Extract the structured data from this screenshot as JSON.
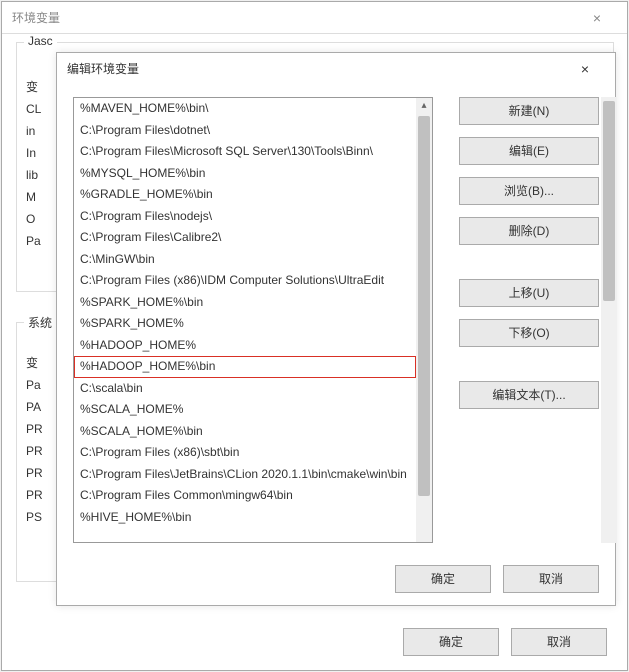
{
  "outer": {
    "title": "环境变量",
    "close": "×",
    "group1_label": "Jasc",
    "group2_label": "系统",
    "left_col_1": [
      "变",
      "CL",
      "in",
      "In",
      "lib",
      "M",
      "O",
      "Pa"
    ],
    "left_col_2": [
      "变",
      "Pa",
      "PA",
      "PR",
      "PR",
      "PR",
      "PR",
      "PS"
    ],
    "ok": "确定",
    "cancel": "取消"
  },
  "inner": {
    "title": "编辑环境变量",
    "close": "×",
    "list": [
      {
        "text": "%MAVEN_HOME%\\bin\\",
        "hl": false
      },
      {
        "text": "C:\\Program Files\\dotnet\\",
        "hl": false
      },
      {
        "text": "C:\\Program Files\\Microsoft SQL Server\\130\\Tools\\Binn\\",
        "hl": false
      },
      {
        "text": "%MYSQL_HOME%\\bin",
        "hl": false
      },
      {
        "text": "%GRADLE_HOME%\\bin",
        "hl": false
      },
      {
        "text": "C:\\Program Files\\nodejs\\",
        "hl": false
      },
      {
        "text": "C:\\Program Files\\Calibre2\\",
        "hl": false
      },
      {
        "text": "C:\\MinGW\\bin",
        "hl": false
      },
      {
        "text": "C:\\Program Files (x86)\\IDM Computer Solutions\\UltraEdit",
        "hl": false
      },
      {
        "text": "%SPARK_HOME%\\bin",
        "hl": false
      },
      {
        "text": "%SPARK_HOME%",
        "hl": false
      },
      {
        "text": "%HADOOP_HOME%",
        "hl": false
      },
      {
        "text": "%HADOOP_HOME%\\bin",
        "hl": true
      },
      {
        "text": "C:\\scala\\bin",
        "hl": false
      },
      {
        "text": "%SCALA_HOME%",
        "hl": false
      },
      {
        "text": "%SCALA_HOME%\\bin",
        "hl": false
      },
      {
        "text": "C:\\Program Files (x86)\\sbt\\bin",
        "hl": false
      },
      {
        "text": "C:\\Program Files\\JetBrains\\CLion 2020.1.1\\bin\\cmake\\win\\bin",
        "hl": false
      },
      {
        "text": "C:\\Program Files Common\\mingw64\\bin",
        "hl": false
      },
      {
        "text": "%HIVE_HOME%\\bin",
        "hl": false
      }
    ],
    "buttons": {
      "new": "新建(N)",
      "edit": "编辑(E)",
      "browse": "浏览(B)...",
      "delete": "删除(D)",
      "move_up": "上移(U)",
      "move_down": "下移(O)",
      "edit_text": "编辑文本(T)..."
    },
    "ok": "确定",
    "cancel": "取消"
  }
}
